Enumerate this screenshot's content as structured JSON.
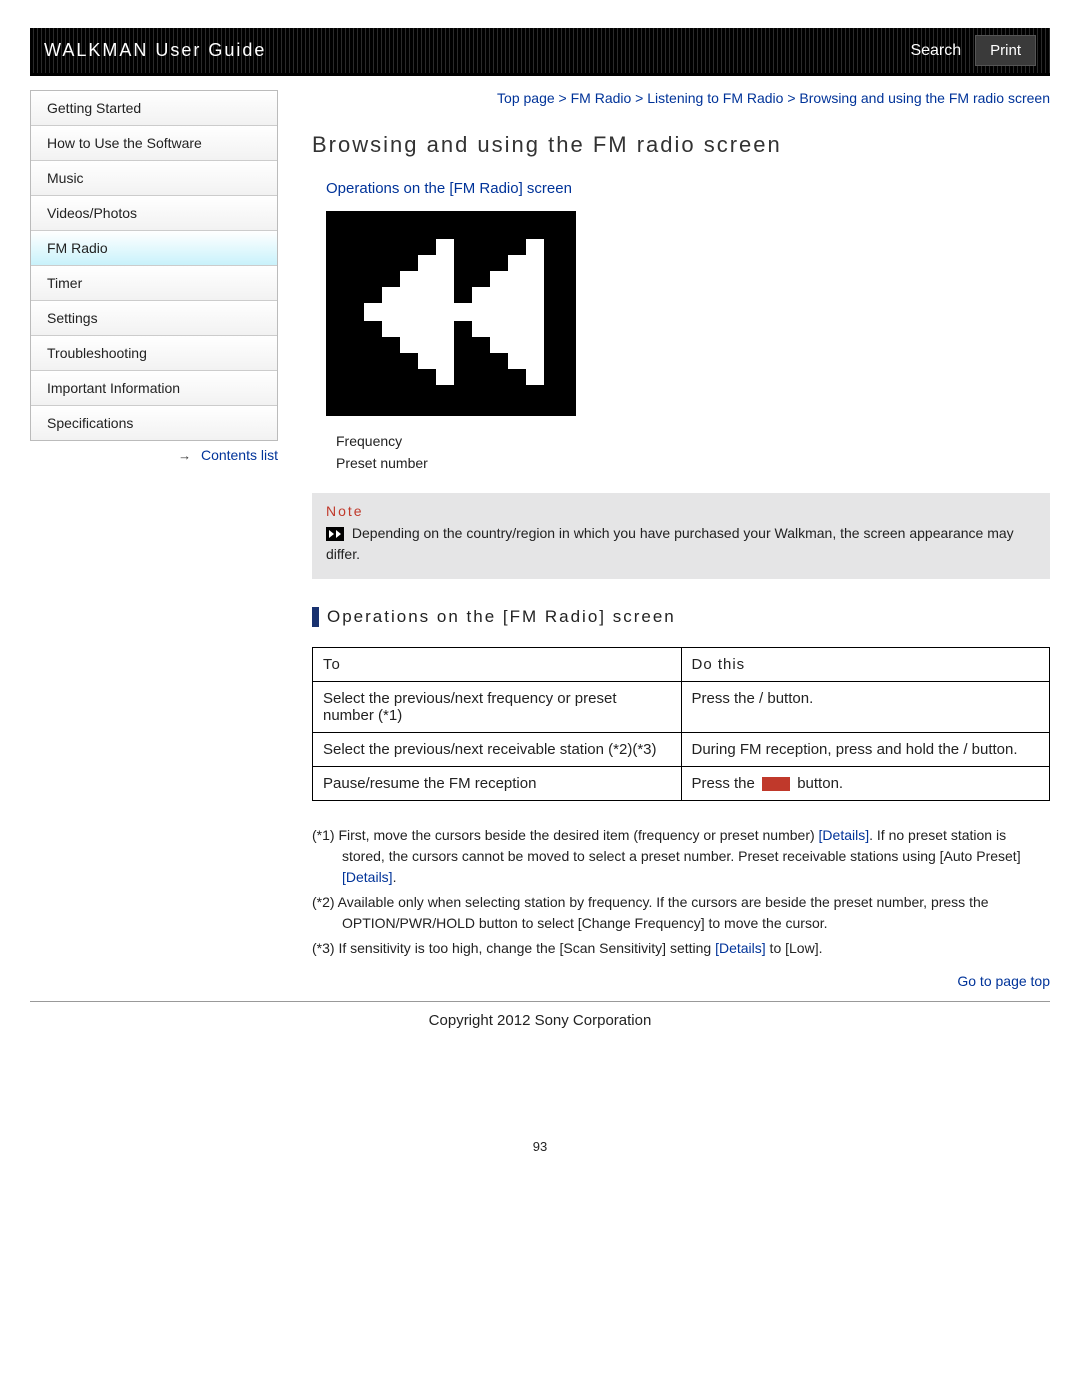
{
  "header": {
    "title": "WALKMAN User Guide",
    "search": "Search",
    "print": "Print"
  },
  "sidebar": {
    "items": [
      {
        "label": "Getting Started"
      },
      {
        "label": "How to Use the Software"
      },
      {
        "label": "Music"
      },
      {
        "label": "Videos/Photos"
      },
      {
        "label": "FM Radio"
      },
      {
        "label": "Timer"
      },
      {
        "label": "Settings"
      },
      {
        "label": "Troubleshooting"
      },
      {
        "label": "Important Information"
      },
      {
        "label": "Specifications"
      }
    ],
    "active_index": 4,
    "contents_list": "Contents list"
  },
  "breadcrumb": {
    "parts": [
      "Top page",
      "FM Radio",
      "Listening to FM Radio",
      "Browsing and using the FM radio screen"
    ],
    "sep": " > "
  },
  "page_title": "Browsing and using the FM radio screen",
  "anchor_link": "Operations on the [FM Radio] screen",
  "img_labels": {
    "l1": "Frequency",
    "l2": "Preset number"
  },
  "note": {
    "label": "Note",
    "text": "Depending on the country/region in which you have purchased your Walkman, the screen appearance may differ."
  },
  "section_head": "Operations on the [FM Radio] screen",
  "table": {
    "h1": "To",
    "h2": "Do this",
    "rows": [
      {
        "to": "Select the previous/next frequency or preset number (*1)",
        "do_a": "Press the ",
        "do_b": " / ",
        "do_c": " button."
      },
      {
        "to": "Select the previous/next receivable station (*2)(*3)",
        "do_a": "During FM reception, press and hold the ",
        "do_b": " / ",
        "do_c": " button."
      },
      {
        "to": "Pause/resume the FM reception",
        "do_a": "Press the ",
        "do_c": " button."
      }
    ]
  },
  "footnotes": {
    "f1a": "(*1) First, move the cursors beside the desired item (frequency or preset number) ",
    "f1_link1": "[Details]",
    "f1b": ". If no preset station is stored, the cursors cannot be moved to select a preset number. Preset receivable stations using [Auto Preset] ",
    "f1_link2": "[Details]",
    "f1c": ".",
    "f2": "(*2) Available only when selecting station by frequency. If the cursors are beside the preset number, press the OPTION/PWR/HOLD button to select [Change Frequency] to move the cursor.",
    "f3a": "(*3) If sensitivity is too high, change the [Scan Sensitivity] setting ",
    "f3_link": "[Details]",
    "f3b": " to [Low]."
  },
  "page_top": "Go to page top",
  "copyright": "Copyright 2012 Sony Corporation",
  "page_number": "93"
}
